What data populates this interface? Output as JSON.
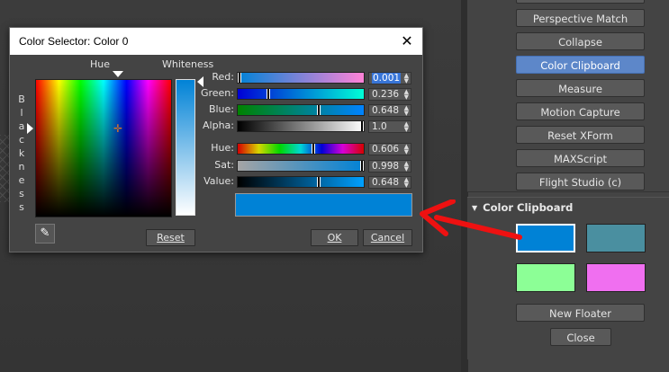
{
  "dialog": {
    "title": "Color Selector: Color 0",
    "close_glyph": "✕",
    "hue_label": "Hue",
    "whiteness_label": "Whiteness",
    "blackness_letters": [
      "B",
      "l",
      "a",
      "c",
      "k",
      "n",
      "e",
      "s",
      "s"
    ],
    "rows": [
      {
        "label": "Red:",
        "value": "0.001",
        "thumb": 0.001
      },
      {
        "label": "Green:",
        "value": "0.236",
        "thumb": 0.236
      },
      {
        "label": "Blue:",
        "value": "0.648",
        "thumb": 0.648
      },
      {
        "label": "Alpha:",
        "value": "1.0",
        "thumb": 1.0
      },
      {
        "label": "Hue:",
        "value": "0.606",
        "thumb": 0.606
      },
      {
        "label": "Sat:",
        "value": "0.998",
        "thumb": 0.998
      },
      {
        "label": "Value:",
        "value": "0.648",
        "thumb": 0.648
      }
    ],
    "preview_color": "#0082d6",
    "reset_label": "Reset",
    "ok_label": "OK",
    "cancel_label": "Cancel",
    "eyedropper_icon": "eyedropper-icon"
  },
  "utilities": {
    "buttons": [
      {
        "label": "Perspective Match",
        "active": false
      },
      {
        "label": "Collapse",
        "active": false
      },
      {
        "label": "Color Clipboard",
        "active": true
      },
      {
        "label": "Measure",
        "active": false
      },
      {
        "label": "Motion Capture",
        "active": false
      },
      {
        "label": "Reset XForm",
        "active": false
      },
      {
        "label": "MAXScript",
        "active": false
      },
      {
        "label": "Flight Studio (c)",
        "active": false
      }
    ]
  },
  "color_clipboard": {
    "title": "Color Clipboard",
    "swatches": [
      "#0082d6",
      "#4a8fa0",
      "#8cff96",
      "#f06ff0"
    ],
    "new_floater_label": "New Floater",
    "close_label": "Close"
  },
  "colors": {
    "accent": "#5d87c9",
    "annotation_arrow": "#ee1111"
  }
}
